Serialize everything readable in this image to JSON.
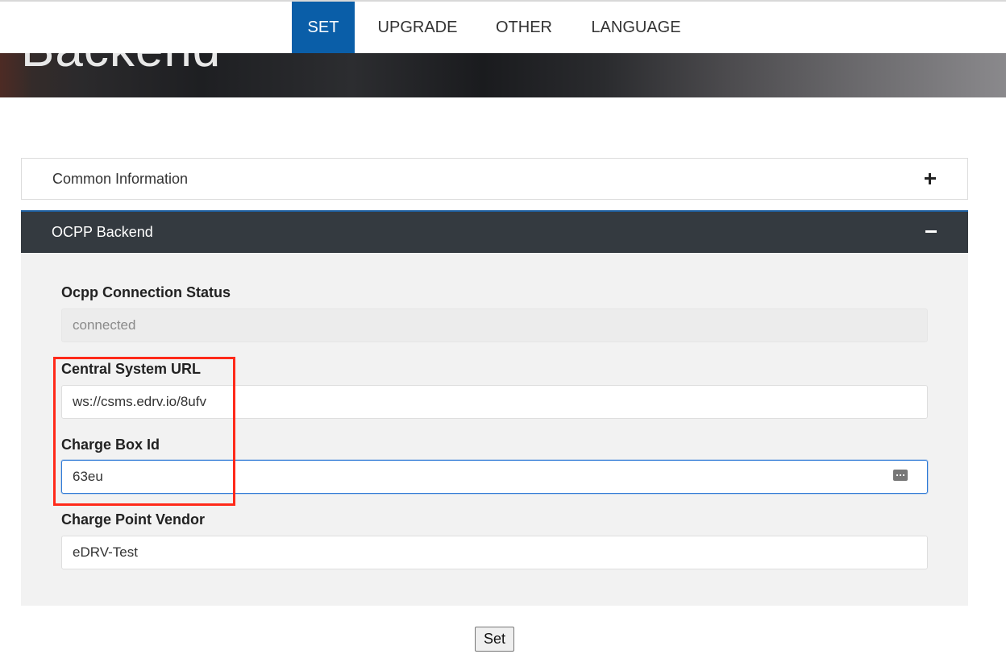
{
  "nav": {
    "items": [
      {
        "label": "SET",
        "active": true
      },
      {
        "label": "UPGRADE",
        "active": false
      },
      {
        "label": "OTHER",
        "active": false
      },
      {
        "label": "LANGUAGE",
        "active": false
      }
    ],
    "active_color": "#0a5ea8"
  },
  "hero": {
    "title": "Backend"
  },
  "panels": {
    "common": {
      "title": "Common Information",
      "toggle_icon": "plus-icon"
    },
    "ocpp": {
      "title": "OCPP Backend",
      "toggle_icon": "minus-icon",
      "header_color": "#343a40"
    }
  },
  "fields": {
    "status": {
      "label": "Ocpp Connection Status",
      "value": "connected"
    },
    "url": {
      "label": "Central System URL",
      "value": "ws://csms.edrv.io/8ufv"
    },
    "box_id": {
      "label": "Charge Box Id",
      "value": "63eu"
    },
    "vendor": {
      "label": "Charge Point Vendor",
      "value": "eDRV-Test"
    }
  },
  "actions": {
    "set_label": "Set"
  },
  "annotation": {
    "color": "#ff2a1a"
  }
}
